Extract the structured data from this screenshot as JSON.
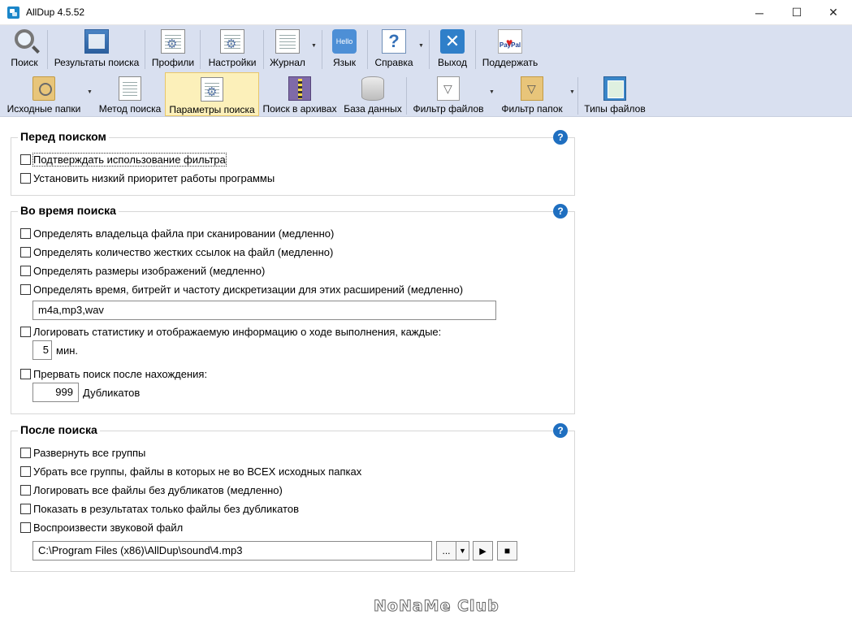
{
  "window": {
    "title": "AllDup 4.5.52",
    "minimize_glyph": "─",
    "maximize_glyph": "☐",
    "close_glyph": "✕"
  },
  "toolbar_main": {
    "items": [
      {
        "label": "Поиск",
        "icon": "search-icon"
      },
      {
        "label": "Результаты поиска",
        "icon": "search-results-icon"
      },
      {
        "label": "Профили",
        "icon": "profiles-icon"
      },
      {
        "label": "Настройки",
        "icon": "settings-icon"
      },
      {
        "label": "Журнал",
        "icon": "log-icon",
        "dropdown": true
      },
      {
        "label": "Язык",
        "icon": "language-icon",
        "icon_text": "Hello"
      },
      {
        "label": "Справка",
        "icon": "help-icon",
        "icon_text": "?",
        "dropdown": true
      },
      {
        "label": "Выход",
        "icon": "exit-icon",
        "icon_text": "✕"
      },
      {
        "label": "Поддержать",
        "icon": "paypal-icon",
        "icon_text": "PayPal"
      }
    ]
  },
  "toolbar_sub": {
    "items": [
      {
        "label": "Исходные папки",
        "icon": "source-folders-icon",
        "dropdown": true
      },
      {
        "label": "Метод поиска",
        "icon": "search-method-icon"
      },
      {
        "label": "Параметры поиска",
        "icon": "search-options-icon",
        "active": true
      },
      {
        "label": "Поиск в архивах",
        "icon": "archive-search-icon"
      },
      {
        "label": "База данных",
        "icon": "database-icon"
      },
      {
        "label": "Фильтр файлов",
        "icon": "file-filter-icon",
        "dropdown": true
      },
      {
        "label": "Фильтр папок",
        "icon": "folder-filter-icon",
        "dropdown": true
      },
      {
        "label": "Типы файлов",
        "icon": "file-types-icon"
      }
    ]
  },
  "before_search": {
    "title": "Перед поиском",
    "help": "?",
    "options": [
      {
        "label": "Подтверждать использование фильтра",
        "checked": false
      },
      {
        "label": "Установить низкий приоритет работы программы",
        "checked": false
      }
    ]
  },
  "during_search": {
    "title": "Во время поиска",
    "help": "?",
    "options": [
      {
        "label": "Определять владельца файла при сканировании (медленно)",
        "checked": false
      },
      {
        "label": "Определять количество жестких ссылок на файл (медленно)",
        "checked": false
      },
      {
        "label": "Определять размеры изображений (медленно)",
        "checked": false
      },
      {
        "label": "Определять время, битрейт и частоту дискретизации для этих расширений (медленно)",
        "checked": false
      },
      {
        "label": "Логировать статистику и отображаемую информацию о ходе выполнения, каждые:",
        "checked": false
      },
      {
        "label": "Прервать поиск после нахождения:",
        "checked": false
      }
    ],
    "extensions_value": "m4a,mp3,wav",
    "log_interval_value": "5",
    "log_interval_unit": "мин.",
    "stop_after_value": "999",
    "stop_after_unit": "Дубликатов"
  },
  "after_search": {
    "title": "После поиска",
    "help": "?",
    "options": [
      {
        "label": "Развернуть все группы",
        "checked": false
      },
      {
        "label": "Убрать все группы, файлы в которых не во ВСЕХ исходных папках",
        "checked": false
      },
      {
        "label": "Логировать все файлы без дубликатов (медленно)",
        "checked": false
      },
      {
        "label": "Показать в результатах только файлы без дубликатов",
        "checked": false
      },
      {
        "label": "Воспроизвести звуковой файл",
        "checked": false
      }
    ],
    "sound_file_value": "C:\\Program Files (x86)\\AllDup\\sound\\4.mp3",
    "browse_label": "...",
    "dropdown_glyph": "▼",
    "play_glyph": "▶",
    "stop_glyph": "■"
  },
  "watermark": "NoNaMe Club"
}
